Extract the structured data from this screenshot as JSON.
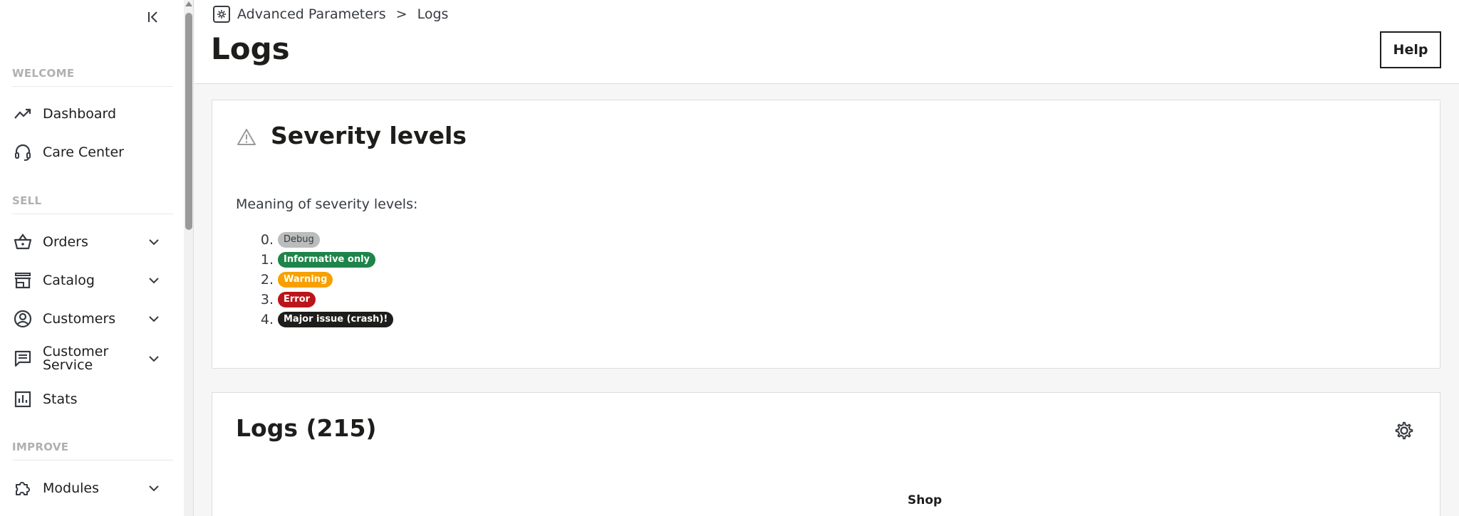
{
  "sidebar": {
    "sections": {
      "welcome": "WELCOME",
      "sell": "SELL",
      "improve": "IMPROVE"
    },
    "items": [
      {
        "label": "Dashboard",
        "icon": "trending-up-icon"
      },
      {
        "label": "Care Center",
        "icon": "headset-icon"
      },
      {
        "label": "Orders",
        "icon": "basket-icon"
      },
      {
        "label": "Catalog",
        "icon": "store-icon"
      },
      {
        "label": "Customers",
        "icon": "account-circle-icon"
      },
      {
        "label": "Customer Service",
        "icon": "chat-icon"
      },
      {
        "label": "Stats",
        "icon": "bar-chart-icon"
      },
      {
        "label": "Modules",
        "icon": "puzzle-icon"
      }
    ]
  },
  "header": {
    "breadcrumb": {
      "parent": "Advanced Parameters",
      "separator": ">",
      "current": "Logs"
    },
    "title": "Logs",
    "help_label": "Help"
  },
  "severity": {
    "title": "Severity levels",
    "meaning": "Meaning of severity levels:",
    "levels": [
      {
        "num": "0.",
        "label": "Debug",
        "color": "#bbbcbc"
      },
      {
        "num": "1.",
        "label": "Informative only",
        "color": "#1e8449"
      },
      {
        "num": "2.",
        "label": "Warning",
        "color": "#f7a000"
      },
      {
        "num": "3.",
        "label": "Error",
        "color": "#ba151a"
      },
      {
        "num": "4.",
        "label": "Major issue (crash)!",
        "color": "#1d1d1b"
      }
    ]
  },
  "logs": {
    "title": "Logs (215)",
    "columns_visible": [
      "Shop"
    ]
  }
}
